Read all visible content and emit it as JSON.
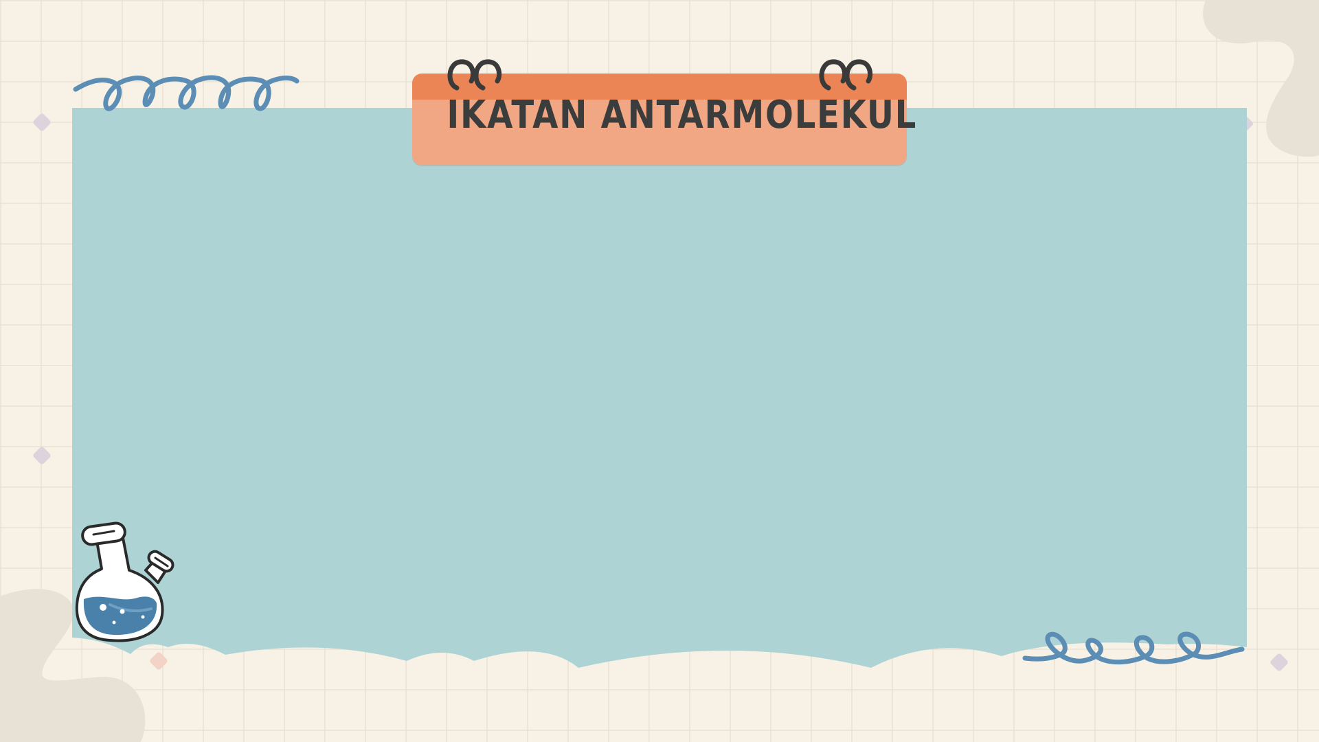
{
  "slide": {
    "title": "IKATAN ANTARMOLEKUL"
  },
  "icons": {
    "flask": "flask-icon",
    "top_spiral": "spiral-icon",
    "bottom_spiral": "spiral-icon",
    "rings": "binder-ring-icon",
    "diamond": "diamond-icon"
  },
  "colors": {
    "background": "#f7f1e6",
    "panel": "#aed3d4",
    "tab_top": "#ec8556",
    "tab_body": "#f1a684",
    "title_text": "#3b3d3d",
    "doodle_blue": "#5b8db5",
    "blob": "#e8e1d5"
  }
}
